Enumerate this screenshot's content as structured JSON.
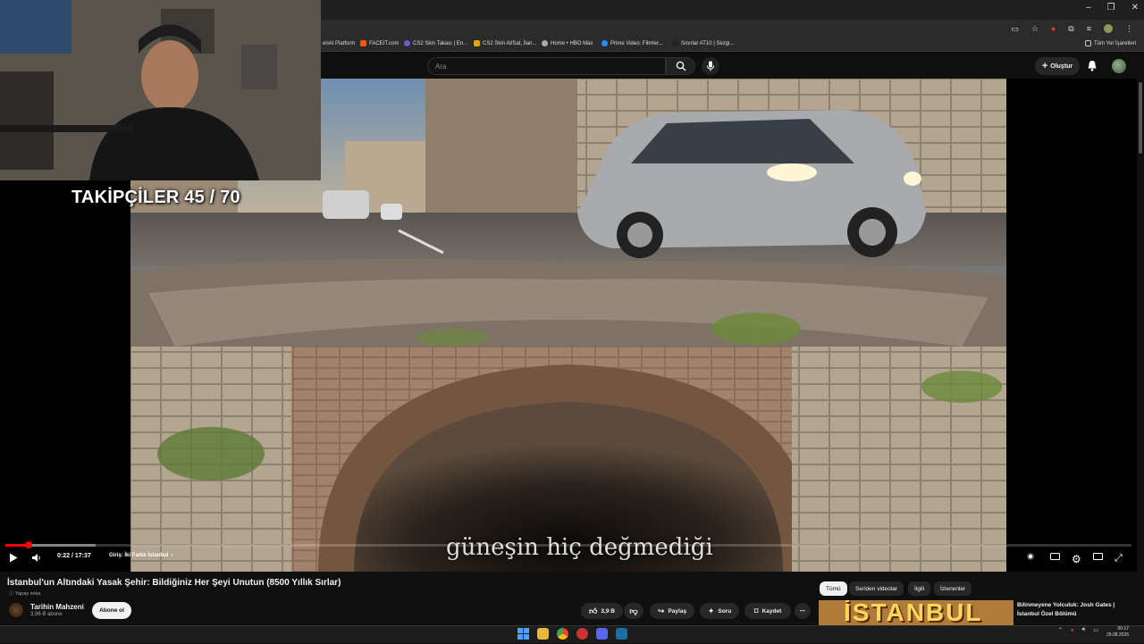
{
  "browser": {
    "bookmarks": [
      {
        "label": "enAI Platform",
        "color": "#777"
      },
      {
        "label": "FACEIT.com",
        "color": "#ff5500"
      },
      {
        "label": "CS2 Skin Takası | En...",
        "color": "#6a5acd"
      },
      {
        "label": "CS2 Skin Al/Sat, İlan...",
        "color": "#e0a800"
      },
      {
        "label": "Home • HBO Max",
        "color": "#aaa"
      },
      {
        "label": "Prime Video: Filmler...",
        "color": "#1e90ff"
      },
      {
        "label": "Sınırlar AT10 | Sezgi...",
        "color": "#222"
      }
    ],
    "all_bookmarks": "Tüm Yer İşaretleri"
  },
  "header": {
    "search_placeholder": "Ara",
    "create_label": "Oluştur"
  },
  "overlay": {
    "followers": "TAKİPÇİLER 45 / 70",
    "subtitle": "güneşin hiç değmediği"
  },
  "player": {
    "time": "0:22 / 17:37",
    "chapter": "Giriş: İki Farklı İstanbul",
    "progress_fraction": 0.0208,
    "buffer_fraction": 0.08
  },
  "video": {
    "title": "İstanbul'un Altındaki Yasak Şehir: Bildiğiniz Her Şeyi Unutun (8500 Yıllık Sırlar)",
    "ai_badge": "Yapay zeka",
    "channel": "Tarihin Mahzeni",
    "subscribers": "3,96 B abone",
    "subscribe": "Abone ol",
    "likes": "3,9 B",
    "share": "Paylaş",
    "ask": "Soru",
    "save": "Kaydet"
  },
  "filters": [
    "Tümü",
    "Seriden videolar",
    "İlgili",
    "İzlenenler"
  ],
  "recommended": {
    "title": "Bilinmeyene Yolculuk: Josh Gates | İstanbul Özel Bölümü",
    "thumb_text": "İSTANBUL"
  },
  "taskbar": {
    "time": "00:17",
    "date": "29.08.2026"
  }
}
